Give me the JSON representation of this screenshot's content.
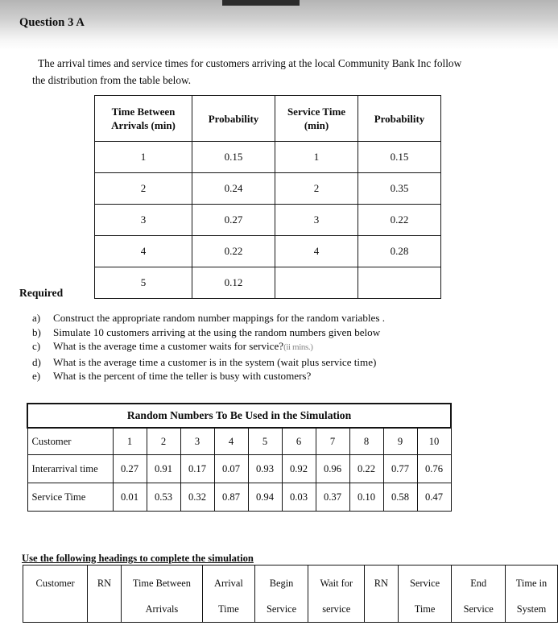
{
  "page": {
    "title": "Question 3 A",
    "scan_bar_color": "#2b2b2b"
  },
  "intro": {
    "line1": "The arrival times and service times for customers arriving at the local Community Bank Inc follow",
    "line2": "the distribution from the table below."
  },
  "dist_table": {
    "headers": [
      "Time Between Arrivals (min)",
      "Probability",
      "Service Time (min)",
      "Probability"
    ],
    "header_lines": [
      [
        "Time Between",
        "Arrivals (min)"
      ],
      [
        "Probability"
      ],
      [
        "Service Time",
        "(min)"
      ],
      [
        "Probability"
      ]
    ],
    "rows": [
      [
        "1",
        "0.15",
        "1",
        "0.15"
      ],
      [
        "2",
        "0.24",
        "2",
        "0.35"
      ],
      [
        "3",
        "0.27",
        "3",
        "0.22"
      ],
      [
        "4",
        "0.22",
        "4",
        "0.28"
      ],
      [
        "5",
        "0.12",
        "",
        ""
      ]
    ]
  },
  "required": {
    "title": "Required",
    "items": [
      {
        "mark": "a)",
        "text": "Construct the appropriate random number mappings for the random variables .",
        "note": ""
      },
      {
        "mark": "b)",
        "text": "Simulate 10 customers arriving at the using the random numbers given below",
        "note": ""
      },
      {
        "mark": "c)",
        "text": "What is the average time a customer waits for service?",
        "note": "(ii mins.)"
      },
      {
        "mark": "d)",
        "text": "What is the average time a customer  is in the system (wait plus service time)",
        "note": ""
      },
      {
        "mark": "e)",
        "text": "What is the percent of time the teller   is busy with customers?",
        "note": ""
      }
    ]
  },
  "random_numbers_table": {
    "title": "Random Numbers To Be Used in the Simulation",
    "row_labels": [
      "Customer",
      "Interarrival time",
      "Service Time"
    ],
    "customers": [
      "1",
      "2",
      "3",
      "4",
      "5",
      "6",
      "7",
      "8",
      "9",
      "10"
    ],
    "interarrival_time": [
      "0.27",
      "0.91",
      "0.17",
      "0.07",
      "0.93",
      "0.92",
      "0.96",
      "0.22",
      "0.77",
      "0.76"
    ],
    "service_time": [
      "0.01",
      "0.53",
      "0.32",
      "0.87",
      "0.94",
      "0.03",
      "0.37",
      "0.10",
      "0.58",
      "0.47"
    ]
  },
  "simulation_table": {
    "instruction": "Use the following headings to complete the simulation",
    "headers": [
      {
        "line1": "Customer",
        "line2": ""
      },
      {
        "line1": "RN",
        "line2": ""
      },
      {
        "line1": "Time Between",
        "line2": "Arrivals"
      },
      {
        "line1": "Arrival",
        "line2": "Time"
      },
      {
        "line1": "Begin",
        "line2": "Service"
      },
      {
        "line1": "Wait for",
        "line2": "service"
      },
      {
        "line1": "RN",
        "line2": ""
      },
      {
        "line1": "Service",
        "line2": "Time"
      },
      {
        "line1": "End",
        "line2": "Service"
      },
      {
        "line1": "Time in",
        "line2": "System"
      }
    ]
  }
}
